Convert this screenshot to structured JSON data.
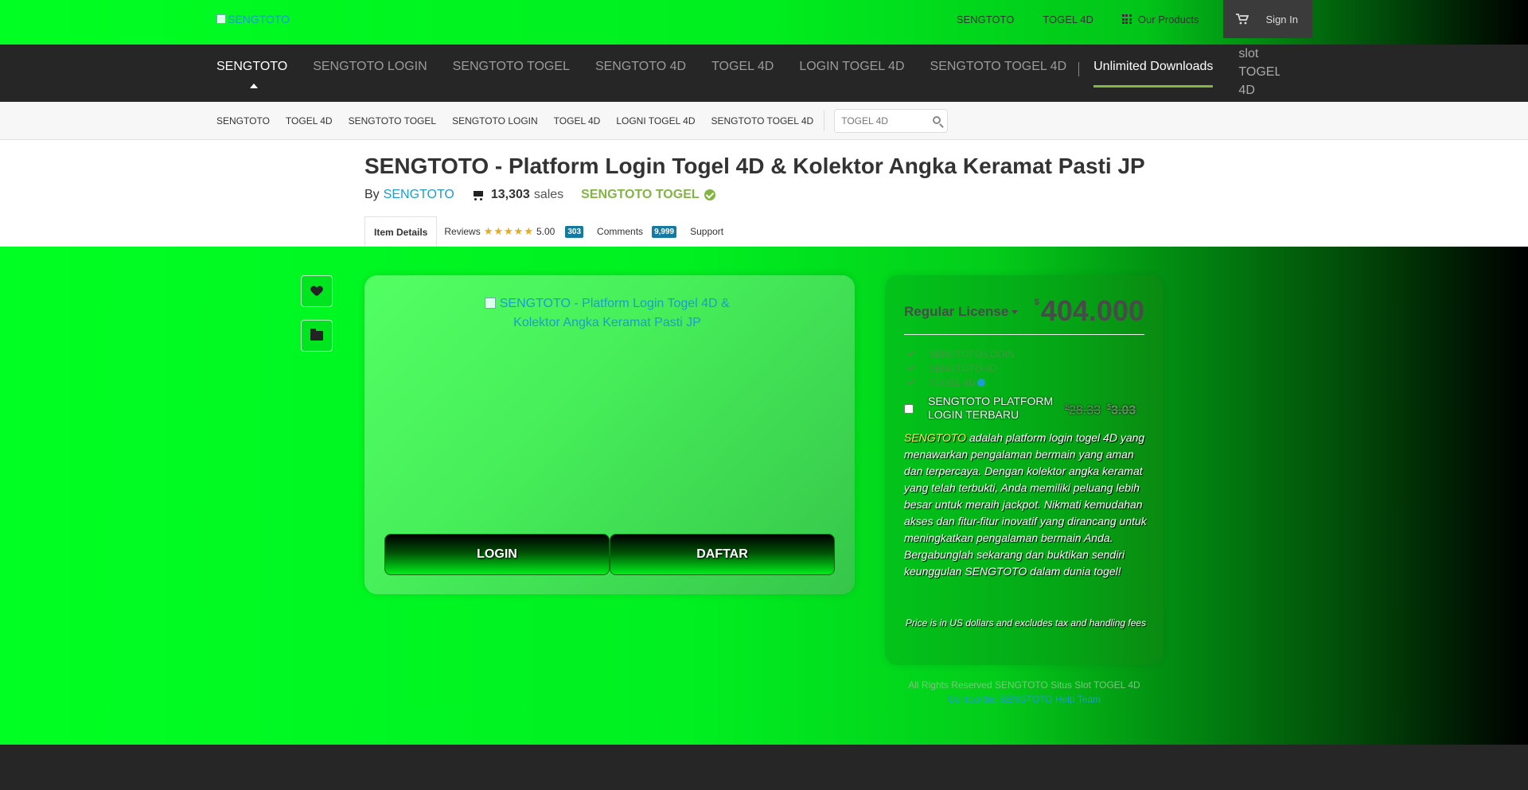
{
  "topbar": {
    "logo_alt": "SENGTOTO",
    "links": [
      "SENGTOTO",
      "TOGEL 4D"
    ],
    "products": "Our Products",
    "signin": "Sign In"
  },
  "catnav": {
    "items": [
      "SENGTOTO",
      "SENGTOTO LOGIN",
      "SENGTOTO TOGEL",
      "SENGTOTO 4D",
      "TOGEL 4D",
      "LOGIN TOGEL 4D",
      "SENGTOTO TOGEL 4D"
    ],
    "unlimited": "Unlimited Downloads",
    "slot_img_alt": "slot TOGEL 4D"
  },
  "subnav": {
    "items": [
      "SENGTOTO",
      "TOGEL 4D",
      "SENGTOTO TOGEL",
      "SENGTOTO LOGIN",
      "TOGEL 4D",
      "LOGNI TOGEL 4D",
      "SENGTOTO TOGEL 4D"
    ],
    "search_placeholder": "TOGEL 4D"
  },
  "item": {
    "title": "SENGTOTO - Platform Login Togel 4D & Kolektor Angka Keramat Pasti JP",
    "by": "By",
    "author": "SENGTOTO",
    "sales_count": "13,303",
    "sales_label": "sales",
    "elite_label": "SENGTOTO TOGEL"
  },
  "tabs": {
    "details": "Item Details",
    "reviews": "Reviews",
    "stars": "★★★★★",
    "rating": "5.00",
    "reviews_count": "303",
    "comments": "Comments",
    "comments_count": "9,999",
    "support": "Support"
  },
  "preview": {
    "img_alt": "SENGTOTO - Platform Login Togel 4D & Kolektor Angka Keramat Pasti JP",
    "login": "LOGIN",
    "daftar": "DAFTAR"
  },
  "license": {
    "label": "Regular License",
    "currency": "$",
    "price": "404.000",
    "features": [
      "SENGTOTO LOGIN",
      "SENGTOTO 4D",
      "TOGEL 4D"
    ],
    "addon_label": "SENGTOTO PLATFORM LOGIN TERBARU",
    "addon_old_price": "28.33",
    "addon_new_price": "3.03",
    "desc_brand": "SENGTOTO",
    "desc_rest": " adalah platform login togel 4D yang menawarkan pengalaman bermain yang aman dan terpercaya. Dengan kolektor angka keramat yang telah terbukti, Anda memiliki peluang lebih besar untuk meraih jackpot. Nikmati kemudahan akses dan fitur-fitur inovatif yang dirancang untuk meningkatkan pengalaman bermain Anda. Bergabunglah sekarang dan buktikan sendiri keunggulan SENGTOTO dalam dunia togel!",
    "note": "Price is in US dollars and excludes tax and handling fees"
  },
  "footer": {
    "copyright": "All Rights Reserved SENGTOTO Situs Slot TOGEL 4D",
    "help": "Contact the SENGTOTO Help Team"
  },
  "colors": {
    "accent_green": "#00ff22",
    "elite_green": "#82b541",
    "link_blue": "#1d9ccf",
    "badge_blue": "#1679a1"
  }
}
